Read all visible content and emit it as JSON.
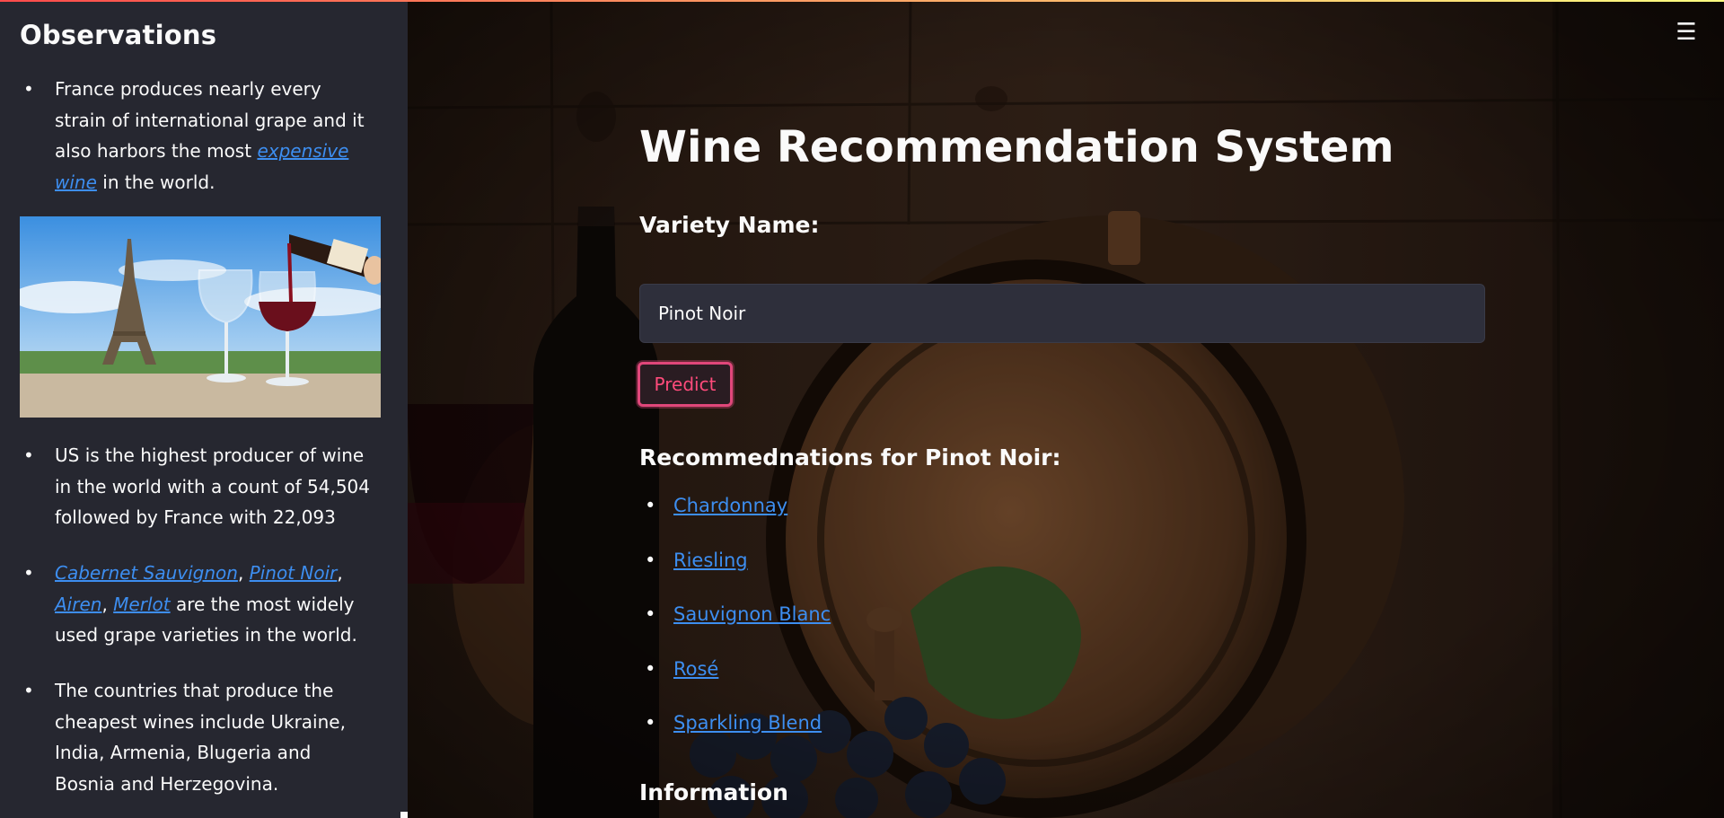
{
  "sidebar": {
    "title": "Observations",
    "obs1": {
      "pre": "France produces nearly every strain of international grape and it also harbors the most ",
      "link": "expensive wine",
      "post": " in the world."
    },
    "obs2": "US is the highest producer of wine in the world with a count of 54,504 followed by France with 22,093",
    "obs3": {
      "link1": "Cabernet Sauvignon",
      "sep1": ", ",
      "link2": "Pinot Noir",
      "sep2": ",",
      "link3": "Airen",
      "sep3": ", ",
      "link4": "Merlot",
      "post": " are the most widely used grape varieties in the world."
    },
    "obs4": "The countries that produce the cheapest wines include Ukraine, India, Armenia, Blugeria and Bosnia and Herzegovina.",
    "bullet": "•"
  },
  "main": {
    "title": "Wine Recommendation System",
    "input_label": "Variety Name:",
    "input_value": "Pinot Noir",
    "predict_label": "Predict",
    "rec_heading": "Recommednations for Pinot Noir:",
    "recommendations": [
      "Chardonnay",
      "Riesling",
      "Sauvignon Blanc",
      "Rosé",
      "Sparkling Blend"
    ],
    "info_heading": "Information",
    "menu_icon": "☰"
  },
  "colors": {
    "sidebar_bg": "#262730",
    "link": "#3d8ef0",
    "accent": "#e0477a",
    "input_bg": "#2e2f3b"
  }
}
